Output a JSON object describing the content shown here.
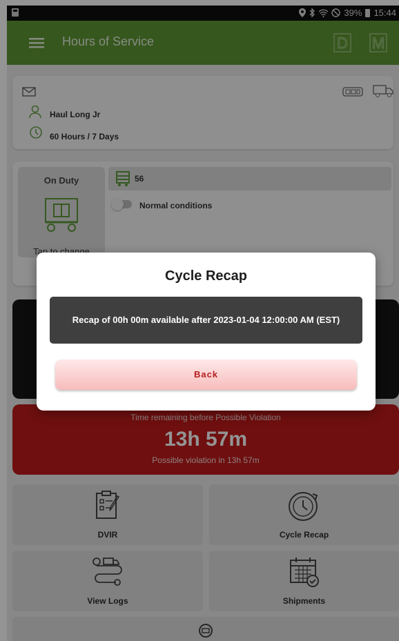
{
  "status_bar": {
    "battery": "39%",
    "time": "15:44"
  },
  "app_bar": {
    "title": "Hours of Service",
    "mode_d": "D",
    "mode_m": "M"
  },
  "driver": {
    "name": "Haul Long Jr",
    "cycle": "60 Hours / 7 Days"
  },
  "duty": {
    "status": "On Duty",
    "tap_hint": "Tap to change",
    "vehicle": "56",
    "conditions": "Normal conditions"
  },
  "violation": {
    "heading": "Time remaining before Possible Violation",
    "time": "13h 57m",
    "subtitle": "Possible violation in 13h 57m"
  },
  "tiles": {
    "dvir": "DVIR",
    "cycle_recap": "Cycle Recap",
    "view_logs": "View Logs",
    "shipments": "Shipments"
  },
  "dialog": {
    "title": "Cycle Recap",
    "message": "Recap of 00h 00m available after 2023-01-04 12:00:00 AM (EST)",
    "back_label": "Back"
  },
  "colors": {
    "app_bar": "#5d9733",
    "violation": "#c01b1b",
    "dialog_button_text": "#b51e1e"
  }
}
